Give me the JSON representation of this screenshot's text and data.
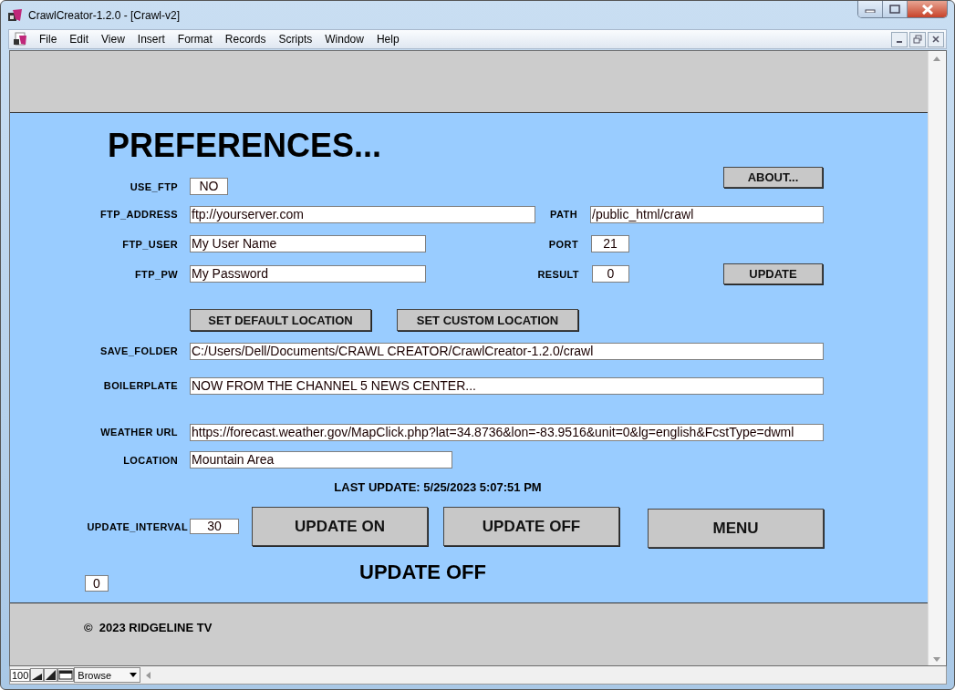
{
  "window": {
    "title": "CrawlCreator-1.2.0 - [Crawl-v2]"
  },
  "menu": [
    "File",
    "Edit",
    "View",
    "Insert",
    "Format",
    "Records",
    "Scripts",
    "Window",
    "Help"
  ],
  "heading": "PREFERENCES...",
  "use_ftp": {
    "label": "USE_FTP",
    "value": "NO"
  },
  "about_button": "ABOUT...",
  "ftp_address": {
    "label": "FTP_ADDRESS",
    "value": "ftp://yourserver.com"
  },
  "path": {
    "label": "PATH",
    "value": "/public_html/crawl"
  },
  "ftp_user": {
    "label": "FTP_USER",
    "value": "My User Name"
  },
  "port": {
    "label": "PORT",
    "value": "21"
  },
  "ftp_pw": {
    "label": "FTP_PW",
    "value": "My Password"
  },
  "result": {
    "label": "RESULT",
    "value": "0"
  },
  "update_button": "UPDATE",
  "location_buttons": [
    "SET DEFAULT LOCATION",
    "SET CUSTOM LOCATION"
  ],
  "save_folder": {
    "label": "SAVE_FOLDER",
    "value": "C:/Users/Dell/Documents/CRAWL CREATOR/CrawlCreator-1.2.0/crawl"
  },
  "boilerplate": {
    "label": "BOILERPLATE",
    "value": "NOW FROM THE CHANNEL 5 NEWS CENTER..."
  },
  "weather_url": {
    "label": "WEATHER URL",
    "value": "https://forecast.weather.gov/MapClick.php?lat=34.8736&lon=-83.9516&unit=0&lg=english&FcstType=dwml"
  },
  "location": {
    "label": "LOCATION",
    "value": "Mountain Area"
  },
  "last_update": "LAST UPDATE: 5/25/2023 5:07:51 PM",
  "update_interval": {
    "label": "UPDATE_INTERVAL",
    "value": "30"
  },
  "action_buttons": [
    "UPDATE ON",
    "UPDATE OFF",
    "MENU"
  ],
  "update_status": "UPDATE OFF",
  "counter": "0",
  "footer": "©  2023 RIDGELINE TV",
  "status_bar": {
    "zoom": "100",
    "mode": "Browse"
  }
}
